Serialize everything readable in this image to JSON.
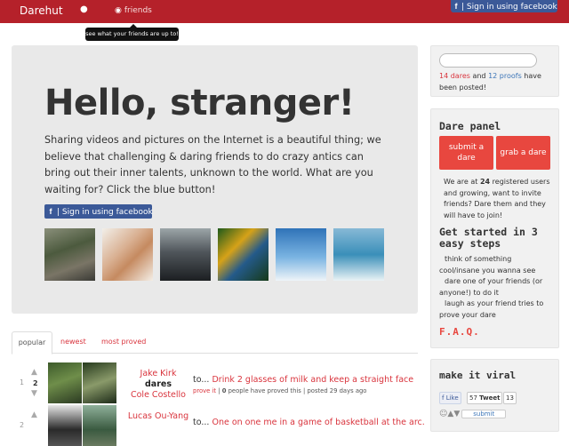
{
  "header": {
    "brand": "Darehut",
    "globe_icon": "globe-icon",
    "friends_icon": "eye-icon",
    "friends_label": "friends",
    "fb_signin_label": "| Sign in using facebook",
    "tooltip": "see what your friends are up to!"
  },
  "hero": {
    "title": "Hello, stranger!",
    "text": "Sharing videos and pictures on the Internet is a beautiful thing; we believe that challenging & daring friends to do crazy antics can bring out their inner talents, unknown to the world. What are you waiting for? Click the blue button!",
    "fb_button_label": "| Sign in using facebook",
    "thumbnails": [
      "skateboarder",
      "couple",
      "group-photo",
      "butterfly",
      "snowboarder",
      "surfer"
    ]
  },
  "tabs": [
    {
      "label": "popular",
      "active": true
    },
    {
      "label": "newest",
      "active": false
    },
    {
      "label": "most proved",
      "active": false
    }
  ],
  "dares": [
    {
      "rank": "1",
      "votes": "2",
      "challenger": "Jake Kirk",
      "dares_word": "dares",
      "target": "Cole Costello",
      "to": "to...",
      "title": "Drink 2 glasses of milk and keep a straight face",
      "prove_link": "prove it",
      "sep1": "|",
      "proved_count": "0",
      "proved_text": "people have proved this",
      "posted": "| posted 29 days ago"
    },
    {
      "rank": "2",
      "votes": "",
      "challenger": "Lucas Ou-Yang",
      "dares_word": "",
      "target": "",
      "to": "to...",
      "title": "One on one me in a game of basketball at the arc.",
      "prove_link": "",
      "sep1": "",
      "proved_count": "",
      "proved_text": "",
      "posted": ""
    }
  ],
  "sidebar": {
    "search_placeholder": "",
    "dares_count": "14 dares",
    "and_text": "and",
    "proofs_count": "12 proofs",
    "stats_suffix": "have been posted!",
    "panel_title": "Dare panel",
    "submit_dare": "submit a dare",
    "grab_dare": "grab a dare",
    "registered_prefix": "We are at",
    "registered_count": "24",
    "registered_suffix": "registered users and growing, want to invite friends? Dare them and they will have to join!",
    "started_title": "Get started in 3 easy steps",
    "step1": "think of something cool/insane you wanna see",
    "step2": "dare one of your friends (or anyone!) to do it",
    "step3": "laugh as your friend tries to prove your dare",
    "faq": "F.A.Q.",
    "viral_title": "make it viral",
    "like_label": "Like",
    "tweet_count": "57",
    "tweet_label": "Tweet",
    "share_count": "13",
    "submit_label": "submit"
  },
  "colors": {
    "topbar": "#b5212a",
    "accent_red": "#d9343d",
    "button_red": "#e8473f",
    "facebook_blue": "#3b5998",
    "link_blue": "#3d76b8"
  }
}
